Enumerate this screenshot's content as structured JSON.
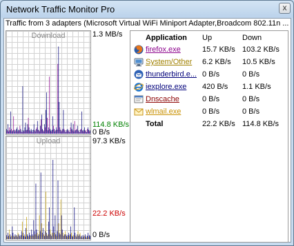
{
  "window": {
    "title": "Network Traffic Monitor Pro",
    "close_glyph": "x"
  },
  "subtitle": "Traffic from 3 adapters (Microsoft Virtual WiFi Miniport Adapter,Broadcom 802.11n ...",
  "graphs": {
    "download": {
      "label": "Download",
      "max_label": "1.3 MB/s",
      "current_label": "114.8 KB/s",
      "current_color": "#008000",
      "zero_label": "0 B/s",
      "bars": [
        6,
        4,
        12,
        3,
        8,
        4,
        28,
        6,
        3,
        4,
        22,
        5,
        3,
        4,
        6,
        8,
        3,
        5,
        4,
        10,
        6,
        3,
        2,
        60,
        4,
        3,
        8,
        14,
        4,
        5,
        12,
        20,
        8,
        4,
        3,
        6,
        4,
        2,
        5,
        12,
        4,
        3,
        6,
        8,
        16,
        5,
        4,
        3,
        10,
        18,
        24,
        6,
        4,
        3,
        12,
        8,
        30,
        52,
        20,
        4,
        8,
        72,
        6,
        4,
        3,
        5,
        22,
        10,
        6,
        3,
        4,
        8,
        5,
        88,
        110,
        40,
        8,
        5,
        3,
        4,
        6,
        30,
        6,
        4,
        2,
        3,
        5,
        6,
        4,
        3,
        2,
        8,
        14,
        6,
        4,
        12,
        3,
        16,
        4,
        5,
        6,
        10,
        4,
        3,
        2,
        5,
        6,
        28,
        4,
        3,
        5,
        8,
        4,
        3,
        2,
        6,
        8,
        5,
        3,
        4
      ],
      "bar_color": "#00007a",
      "accent_color": "#8b008b"
    },
    "upload": {
      "label": "Upload",
      "max_label": "97.3 KB/s",
      "current_label": "22.2 KB/s",
      "current_color": "#cc0000",
      "zero_label": "0 B/s",
      "bars": [
        5,
        3,
        8,
        4,
        12,
        6,
        3,
        4,
        16,
        8,
        4,
        3,
        6,
        4,
        5,
        3,
        8,
        6,
        4,
        3,
        5,
        10,
        22,
        8,
        4,
        6,
        3,
        14,
        28,
        6,
        4,
        3,
        8,
        5,
        4,
        12,
        6,
        4,
        24,
        10,
        6,
        70,
        12,
        8,
        4,
        6,
        30,
        10,
        84,
        20,
        8,
        14,
        6,
        4,
        10,
        60,
        8,
        4,
        6,
        22,
        40,
        12,
        6,
        4,
        8,
        100,
        16,
        8,
        30,
        6,
        4,
        10,
        74,
        20,
        8,
        6,
        50,
        30,
        12,
        8,
        4,
        6,
        10,
        6,
        4,
        3,
        5,
        8,
        4,
        6,
        16,
        8,
        4,
        3,
        5,
        40,
        8,
        4,
        3,
        6,
        10,
        4,
        6,
        8,
        3,
        4,
        2,
        5,
        3,
        4,
        6,
        3,
        2,
        4,
        8,
        3,
        5,
        4
      ],
      "bar_color": "#00007a",
      "accent_color": "#c8a000"
    }
  },
  "table": {
    "headers": {
      "app": "Application",
      "up": "Up",
      "down": "Down"
    },
    "rows": [
      {
        "name": "firefox.exe",
        "up": "15.7 KB/s",
        "down": "103.2 KB/s",
        "color": "#8b008b",
        "icon": "firefox-icon"
      },
      {
        "name": "System/Other",
        "up": "6.2 KB/s",
        "down": "10.5 KB/s",
        "color": "#a08000",
        "icon": "system-icon"
      },
      {
        "name": "thunderbird.e...",
        "up": "0 B/s",
        "down": "0 B/s",
        "color": "#00007a",
        "icon": "thunderbird-icon"
      },
      {
        "name": "iexplore.exe",
        "up": "420 B/s",
        "down": "1.1 KB/s",
        "color": "#00007a",
        "icon": "ie-icon"
      },
      {
        "name": "Dnscache",
        "up": "0 B/s",
        "down": "0 B/s",
        "color": "#8b0000",
        "icon": "dnscache-icon"
      },
      {
        "name": "wlmail.exe",
        "up": "0 B/s",
        "down": "0 B/s",
        "color": "#c89000",
        "icon": "wlmail-icon"
      }
    ],
    "total": {
      "name": "Total",
      "up": "22.2 KB/s",
      "down": "114.8 KB/s"
    }
  }
}
